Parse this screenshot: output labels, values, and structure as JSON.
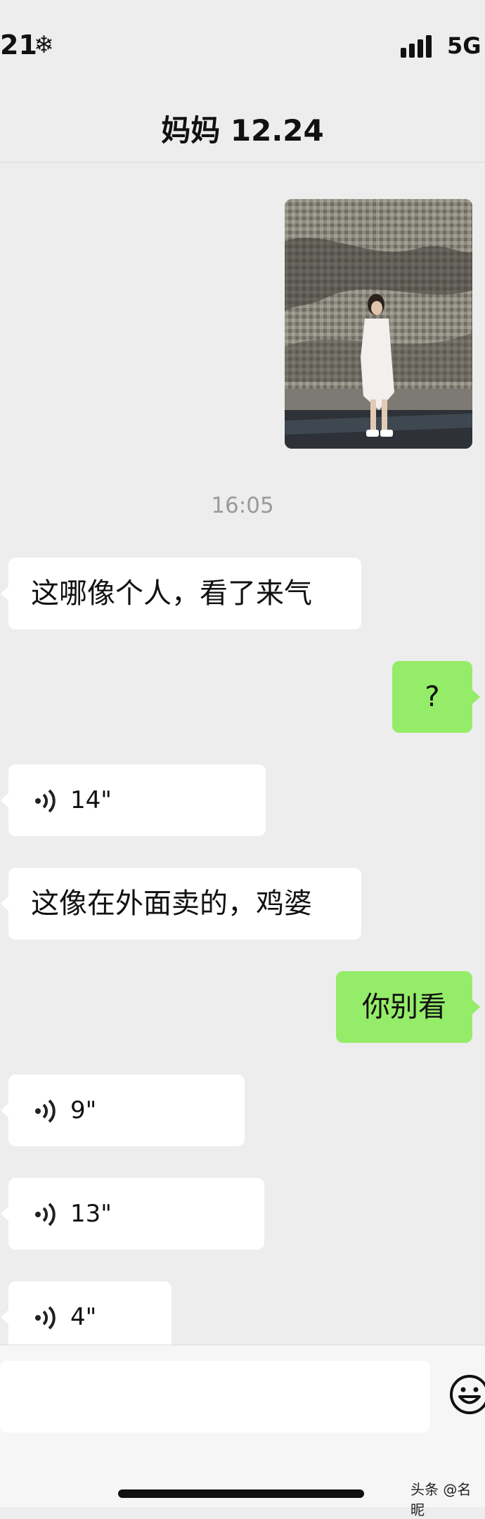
{
  "status_bar": {
    "time": "21",
    "weather_icon": "snowflake-icon",
    "network": "5G"
  },
  "header": {
    "title": "妈妈 12.24"
  },
  "chat": {
    "timestamp": "16:05",
    "messages": [
      {
        "side": "out",
        "type": "image"
      },
      {
        "side": "in",
        "type": "text",
        "text": "这哪像个人，看了来气"
      },
      {
        "side": "out",
        "type": "text",
        "text": "?"
      },
      {
        "side": "in",
        "type": "voice",
        "duration": "14\""
      },
      {
        "side": "in",
        "type": "text",
        "text": "这像在外面卖的，鸡婆"
      },
      {
        "side": "out",
        "type": "text",
        "text": "你别看"
      },
      {
        "side": "in",
        "type": "voice",
        "duration": "9\""
      },
      {
        "side": "in",
        "type": "voice",
        "duration": "13\""
      },
      {
        "side": "in",
        "type": "voice",
        "duration": "4\""
      }
    ]
  },
  "input_bar": {
    "value": "",
    "emoji_icon": "emoji-icon"
  },
  "watermark": "头条 @名昵",
  "colors": {
    "background": "#ededed",
    "outgoing_bubble": "#95ec69",
    "incoming_bubble": "#ffffff",
    "timestamp": "#9a9a9a"
  }
}
